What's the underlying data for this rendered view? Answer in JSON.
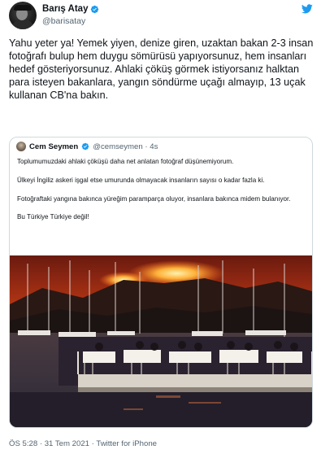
{
  "author": {
    "name": "Barış Atay",
    "handle": "@barisatay"
  },
  "tweet": {
    "text": "Yahu yeter ya! Yemek yiyen, denize giren, uzaktan bakan 2-3 insan fotoğrafı bulup hem duygu sömürüsü yapıyorsunuz, hem insanları hedef gösteriyorsunuz. Ahlaki çöküş görmek istiyorsanız halktan para isteyen bakanlara, yangın söndürme uçağı almayıp, 13 uçak kullanan CB'na bakın."
  },
  "quoted": {
    "name": "Cem Seymen",
    "meta": "@cemseymen · 4s",
    "paragraphs": [
      "Toplumumuzdaki ahlaki çöküşü daha net anlatan fotoğraf düşünemiyorum.",
      "Ülkeyi İngiliz askeri işgal etse umurunda olmayacak insanların sayısı o kadar fazla ki.",
      "Fotoğraftaki yangına bakınca yüreğim paramparça oluyor, insanlara bakınca midem bulanıyor.",
      "Bu Türkiye Türkiye değil!"
    ]
  },
  "footer": {
    "timestamp": "ÖS 5:28 · 31 Tem 2021 · Twitter for iPhone"
  },
  "icons": {
    "verified": "verified-badge-icon",
    "logo": "twitter-bird-icon"
  },
  "colors": {
    "accent": "#1d9bf0",
    "text": "#0f1419",
    "secondary": "#536471",
    "border": "#cfd9de"
  }
}
